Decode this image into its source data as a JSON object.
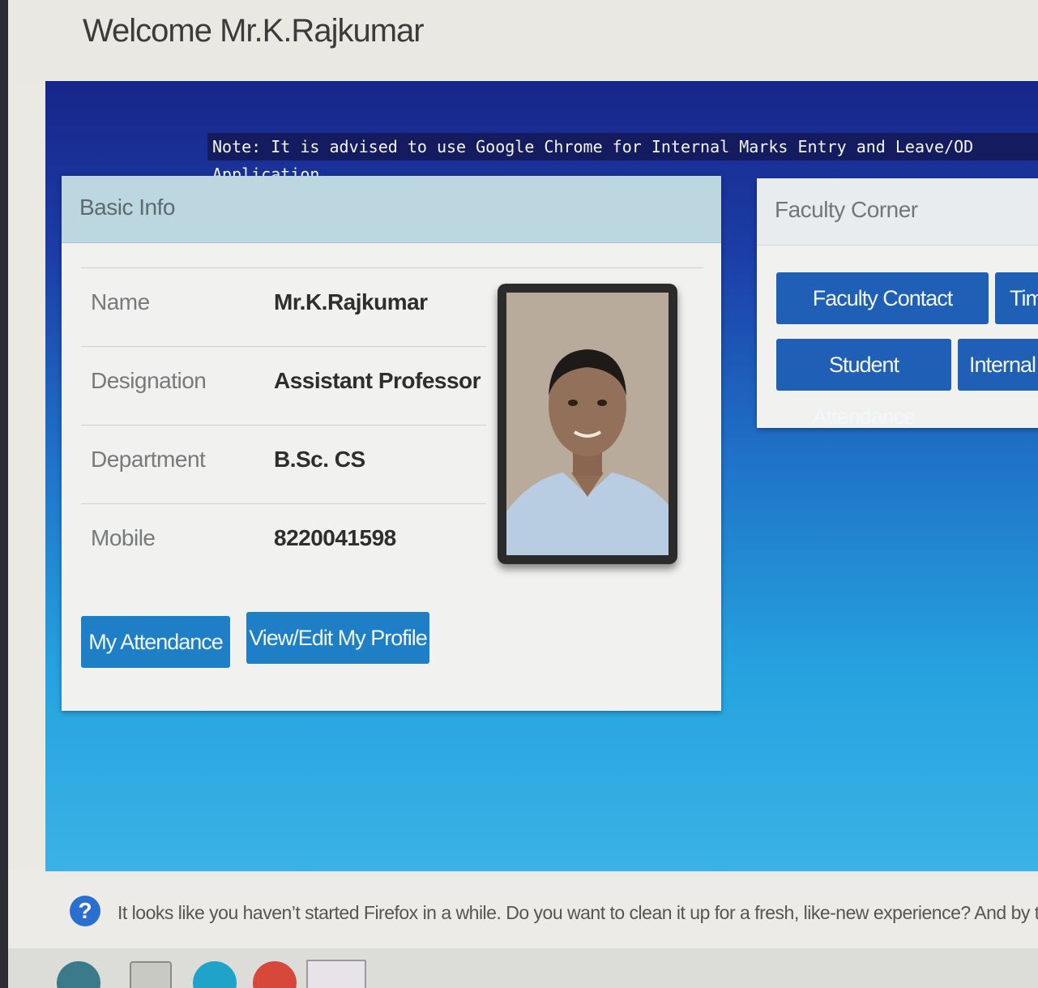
{
  "header": {
    "title": "Welcome Mr.K.Rajkumar"
  },
  "note": "Note: It is advised to use Google Chrome for Internal Marks Entry and Leave/OD Application",
  "basic_info": {
    "heading": "Basic Info",
    "rows": [
      {
        "label": "Name",
        "value": "Mr.K.Rajkumar"
      },
      {
        "label": "Designation",
        "value": "Assistant Professor"
      },
      {
        "label": "Department",
        "value": "B.Sc. CS"
      },
      {
        "label": "Mobile",
        "value": "8220041598"
      }
    ],
    "buttons": {
      "attendance": "My Attendance",
      "profile": "View/Edit My Profile"
    }
  },
  "faculty_corner": {
    "heading": "Faculty Corner",
    "buttons": [
      "Faculty Contact Numbers",
      "Tim",
      "Student Attendance",
      "Internal"
    ]
  },
  "notification": {
    "icon": "help-icon",
    "message": "It looks like you haven’t started Firefox in a while. Do you want to clean it up for a fresh, like-new experience? And by the way, welco"
  },
  "colors": {
    "accent": "#1e7fc6",
    "panel_head": "#bcd7df",
    "note_bg": "#141b5f"
  }
}
